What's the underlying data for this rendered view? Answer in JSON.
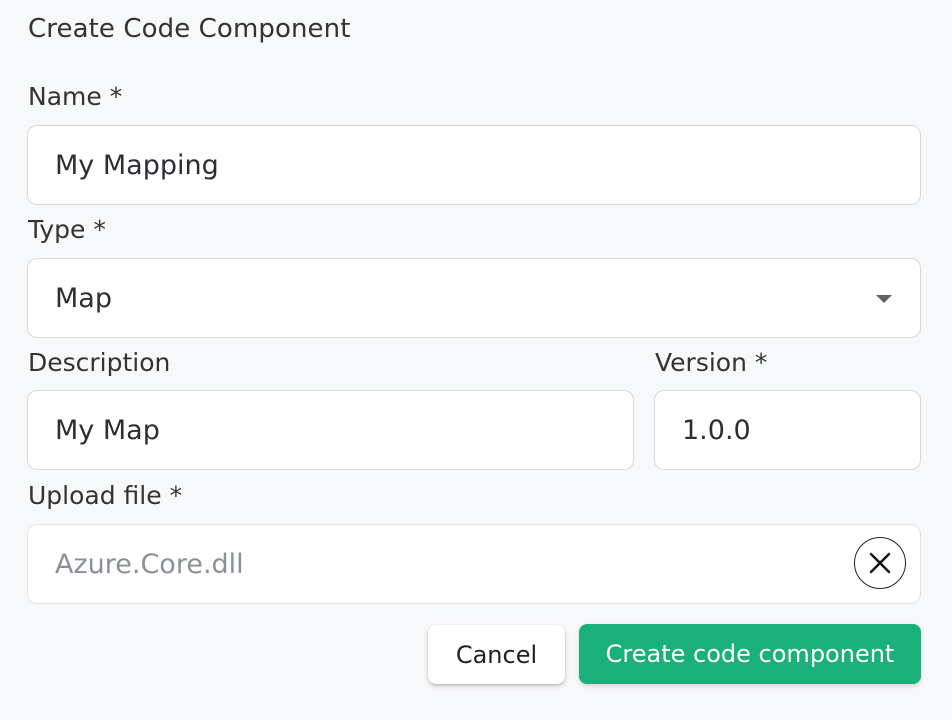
{
  "dialog": {
    "title": "Create Code Component"
  },
  "form": {
    "name": {
      "label": "Name *",
      "value": "My Mapping"
    },
    "type": {
      "label": "Type *",
      "value": "Map"
    },
    "description": {
      "label": "Description",
      "value": "My Map"
    },
    "version": {
      "label": "Version *",
      "value": "1.0.0"
    },
    "upload": {
      "label": "Upload file *",
      "value": "Azure.Core.dll"
    }
  },
  "actions": {
    "cancel_label": "Cancel",
    "create_label": "Create code component"
  },
  "icons": {
    "type_dropdown": "caret-down-icon",
    "clear_file": "close-icon"
  },
  "colors": {
    "primary": "#19b07a",
    "background": "#f7f8f9",
    "field_border": "#d6d9dd"
  }
}
